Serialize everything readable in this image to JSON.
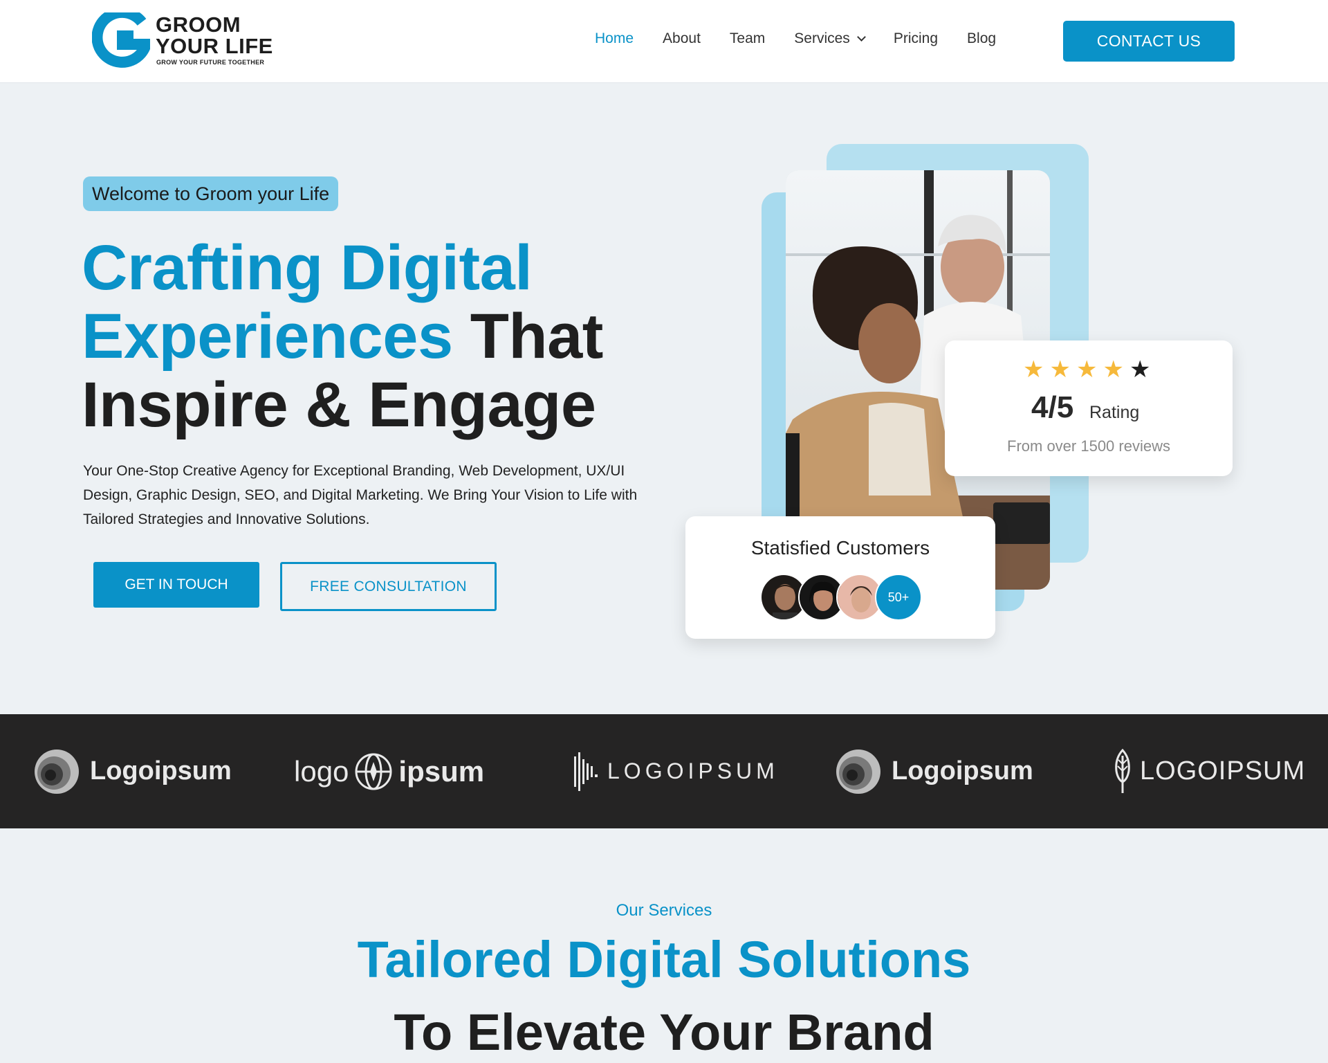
{
  "colors": {
    "accent": "#0a92c8",
    "dark": "#1f1f1f",
    "strip": "#252424",
    "star": "#f6b93b"
  },
  "brand": {
    "line1": "GROOM",
    "line2": "YOUR LIFE",
    "tagline": "GROW YOUR FUTURE TOGETHER",
    "icon": "g-logo-icon"
  },
  "nav": {
    "items": [
      {
        "label": "Home"
      },
      {
        "label": "About"
      },
      {
        "label": "Team"
      },
      {
        "label": "Services"
      },
      {
        "label": "Pricing"
      },
      {
        "label": "Blog"
      }
    ],
    "active": "Home",
    "contact_label": "CONTACT US"
  },
  "hero": {
    "welcome": "Welcome to Groom your Life",
    "headline_blue_1": "Crafting Digital",
    "headline_blue_2": "Experiences",
    "headline_dark_1": "That",
    "headline_dark_2": "Inspire & Engage",
    "description": "Your One-Stop Creative Agency for Exceptional Branding, Web Development, UX/UI Design, Graphic Design, SEO, and Digital Marketing. We Bring Your Vision to Life with Tailored Strategies and Innovative Solutions.",
    "cta_primary": "GET IN TOUCH",
    "cta_secondary": "FREE CONSULTATION"
  },
  "rating": {
    "stars_filled": 4,
    "stars_total": 5,
    "value": "4/5",
    "label": "Rating",
    "sub": "From over 1500 reviews"
  },
  "customers": {
    "title": "Statisfied Customers",
    "more": "50+"
  },
  "logos": [
    {
      "text": "Logoipsum"
    },
    {
      "text_a": "logo",
      "text_b": "ipsum"
    },
    {
      "text": "LOGOIPSUM"
    },
    {
      "text": "Logoipsum"
    },
    {
      "text": "LOGOIPSUM"
    }
  ],
  "services": {
    "kicker": "Our Services",
    "title_1": "Tailored Digital Solutions",
    "title_2": "To Elevate Your Brand"
  }
}
